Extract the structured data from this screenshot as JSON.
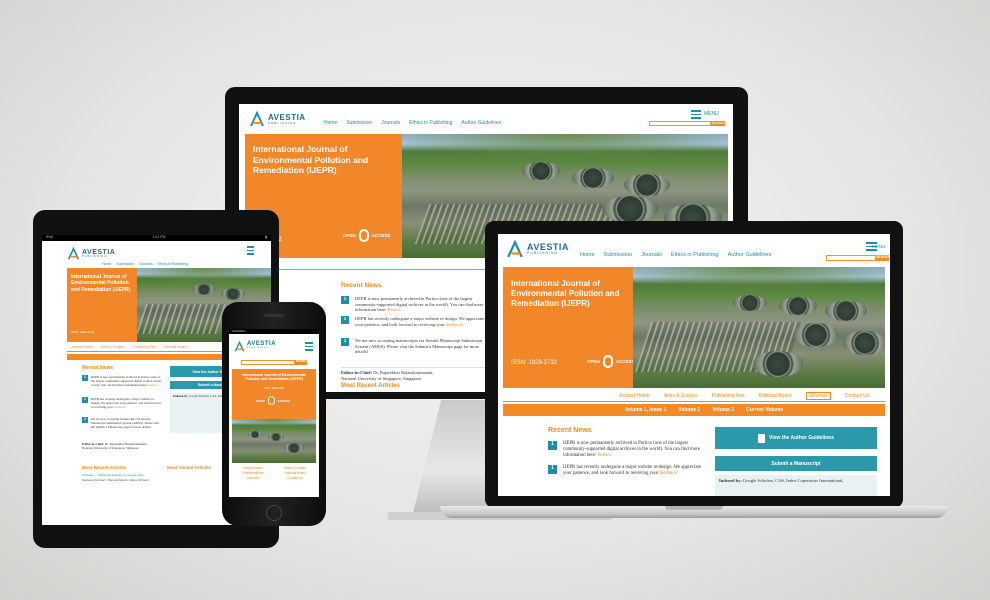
{
  "site": {
    "logo_name": "AVESTIA",
    "logo_sub": "PUBLISHING",
    "nav": [
      "Home",
      "Submission",
      "Journals",
      "Ethics in Publishing",
      "Author Guidelines"
    ],
    "menu_label": "MENU",
    "search_btn": "SEARCH",
    "hero_title": "International Journal of Environmental Pollution and Remediation (IJEPR)",
    "issn": "ISSN: 1929-2732",
    "issn_short": "1929-2732",
    "open_access": [
      "OPEN",
      "ACCESS"
    ],
    "subnav": [
      "Journal Home",
      "Aims & Scopes",
      "Publishing Fee",
      "Editorial Board",
      "Volumes",
      "Contact Us"
    ],
    "volumes": [
      "Volume 1, Issue 1",
      "Volume 2",
      "Volume 3",
      "Current Volume"
    ],
    "recent_news_title": "Recent News",
    "news": [
      {
        "num": "1",
        "text": "IJEPR is now permanently archived in Portico (one of the largest community-supported digital archives in the world). You can find more information here: ",
        "link": "Portico."
      },
      {
        "num": "1",
        "text": "IJEPR has recently undergone a major website re-design. We appreciate your patience, and look forward to receiving your ",
        "link": "feedback!"
      },
      {
        "num": "1",
        "text": "We are now accepting manuscripts via Avestia Manuscript Submission System (AMSS). Please visit the Submit a Manuscript page for more details!",
        "link": ""
      }
    ],
    "author_guidelines_btn": "View the Author Guidelines",
    "submit_btn": "Submit a Manuscript",
    "indexed_label": "Indexed by:",
    "indexed_text": "Google Scholars, CAS, Index Copernicus International,",
    "editor_label": "Editor-in-Chief:",
    "editor_name": "Dr. Rajasekhar Balasubramanian,",
    "editor_affil": "National University of Singapore, Singapore",
    "most_recent_title": "Most Recent Articles",
    "most_visited_title": "Most Visited Articles",
    "recent_article": "Chitosan — A Natural Sorbent for Copper Ions",
    "recent_authors": "Roksana Schwarz, Manolis Marcin, Dana Schwarz"
  },
  "phone": {
    "carrier": "CARRIER",
    "subnav": [
      "Journal Home",
      "Aims & Scopes",
      "Publishing Fee",
      "Editorial Board",
      "Volumes",
      "Contact Us"
    ]
  },
  "tablet": {
    "status_left": "iPad",
    "status_time": "1:41 PM"
  },
  "colors": {
    "brand_teal": "#1e8fa6",
    "brand_orange": "#f28a25",
    "button_teal": "#2a9aaa"
  }
}
